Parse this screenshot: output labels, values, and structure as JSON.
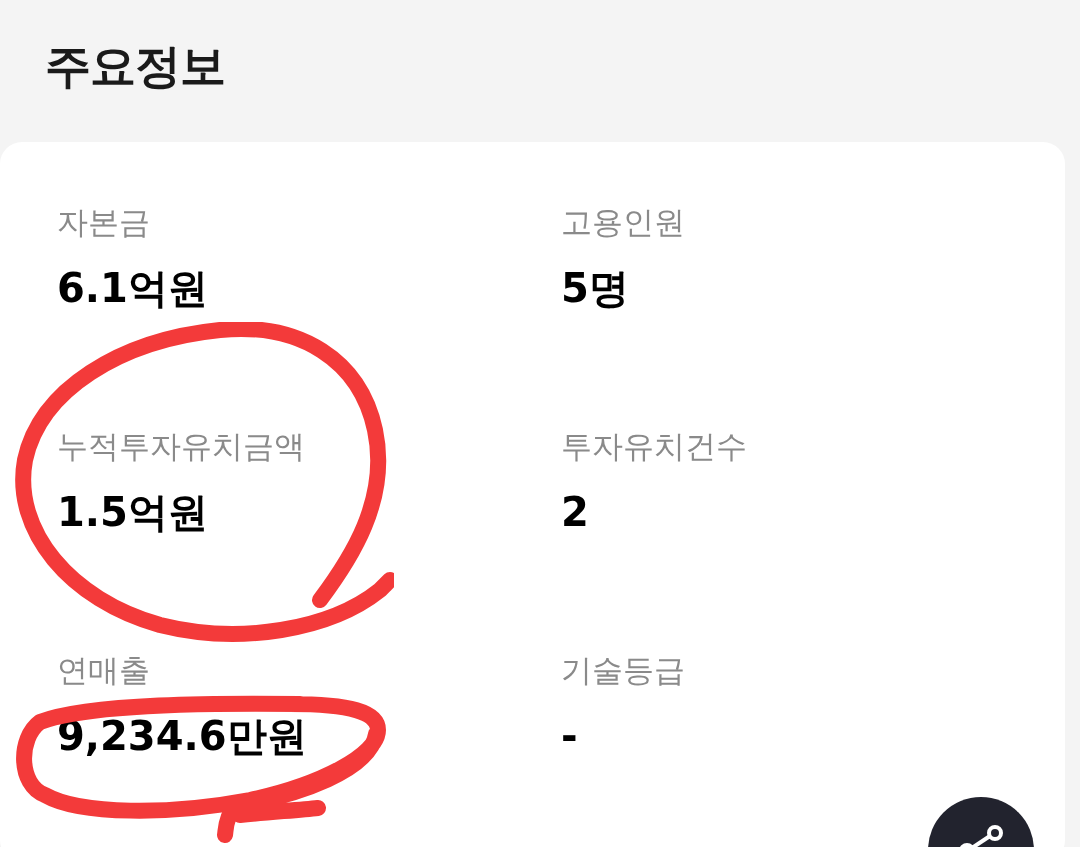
{
  "title": "주요정보",
  "stats": [
    {
      "label": "자본금",
      "value": "6.1억원"
    },
    {
      "label": "고용인원",
      "value": "5명"
    },
    {
      "label": "누적투자유치금액",
      "value": "1.5억원"
    },
    {
      "label": "투자유치건수",
      "value": "2"
    },
    {
      "label": "연매출",
      "value": "9,234.6만원"
    },
    {
      "label": "기술등급",
      "value": "-"
    }
  ]
}
